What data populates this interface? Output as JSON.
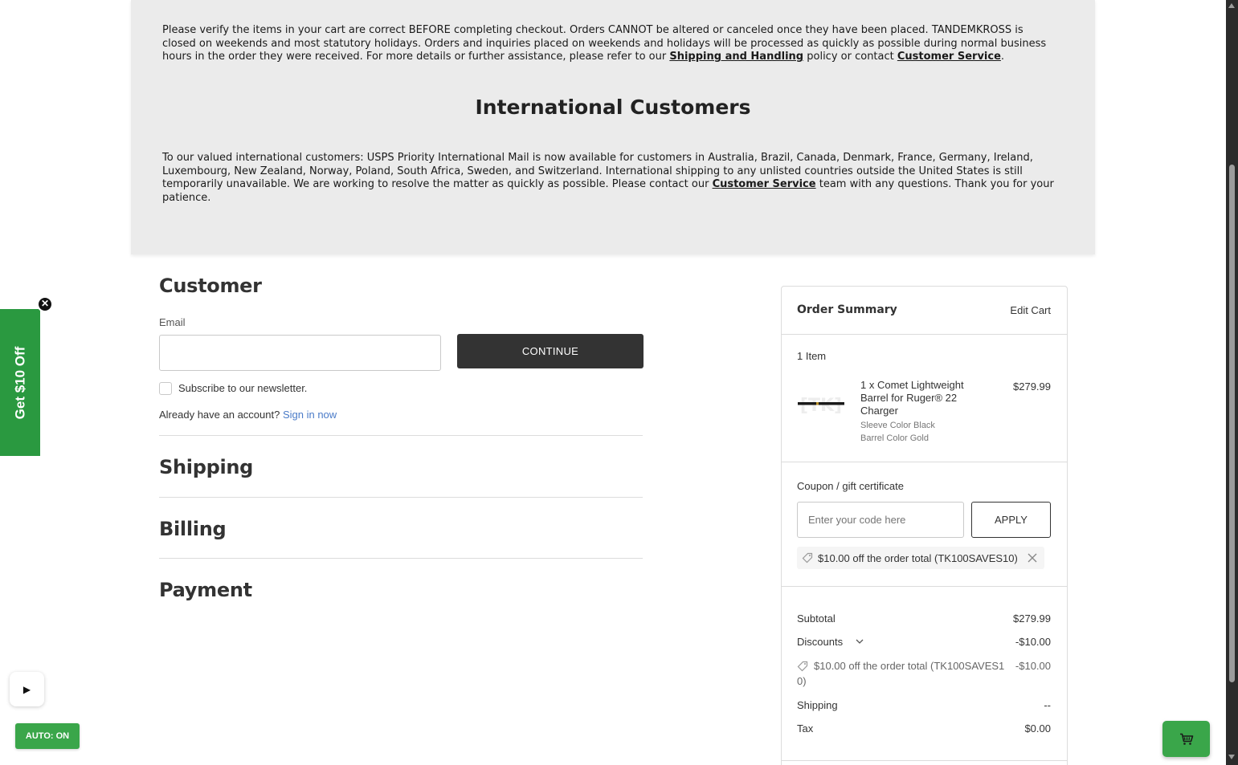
{
  "notice": {
    "p1_text": "Please verify the items in your cart are correct BEFORE completing checkout. Orders CANNOT be altered or canceled once they have been placed. TANDEMKROSS is closed on weekends and most statutory holidays. Orders and inquiries placed on weekends and holidays will be processed as quickly as possible during normal business hours in the order they were received. For more details or further assistance, please refer to our ",
    "p1_link1": "Shipping and Handling",
    "p1_mid": " policy or contact ",
    "p1_link2": "Customer Service",
    "p1_end": ".",
    "heading": "International Customers",
    "p2_text": "To our valued international customers: USPS Priority International Mail is now available for customers in Australia, Brazil, Canada, Denmark, France, Germany, Ireland, Luxembourg, New Zealand, Norway, Poland, South Africa, Sweden, and Switzerland. International shipping to any unlisted countries outside the United States is still temporarily unavailable. We are working to resolve the matter as quickly as possible. Please contact our ",
    "p2_link": "Customer Service",
    "p2_end": " team with any questions. Thank you for your patience."
  },
  "checkout": {
    "customer_title": "Customer",
    "email_label": "Email",
    "email_value": "",
    "continue_label": "CONTINUE",
    "newsletter_label": "Subscribe to our newsletter.",
    "account_prompt": "Already have an account?",
    "sign_in": "Sign in now",
    "shipping_title": "Shipping",
    "billing_title": "Billing",
    "payment_title": "Payment"
  },
  "summary": {
    "title": "Order Summary",
    "edit_cart": "Edit Cart",
    "item_count": "1 Item",
    "product_image_text": "[TK]",
    "product_name_1": "1 x Comet Lightweight",
    "product_name_2": "Barrel for Ruger® 22",
    "product_name_3": "Charger",
    "option_1": "Sleeve Color Black",
    "option_2": "Barrel Color Gold",
    "product_price": "$279.99",
    "coupon_link": "Coupon / gift certificate",
    "coupon_placeholder": "Enter your code here",
    "apply_label": "APPLY",
    "coupon_applied": "$10.00 off the order total (TK100SAVES10)",
    "subtotal_label": "Subtotal",
    "subtotal_value": "$279.99",
    "discounts_label": "Discounts",
    "discounts_value": "-$10.00",
    "discount_line_1": "$10.00 off the order total (TK100SAVES1",
    "discount_line_2": "0)",
    "discount_line_value": "-$10.00",
    "shipping_label": "Shipping",
    "shipping_value": "--",
    "tax_label": "Tax",
    "tax_value": "$0.00"
  },
  "widgets": {
    "promo_label": "Get $10 Off",
    "promo_close": "✕",
    "play_icon": "▶",
    "auto_label": "AUTO: ON"
  },
  "colors": {
    "accent_link": "#4a7bc8",
    "promo_green": "#2a9940",
    "button_dark": "#333333"
  }
}
